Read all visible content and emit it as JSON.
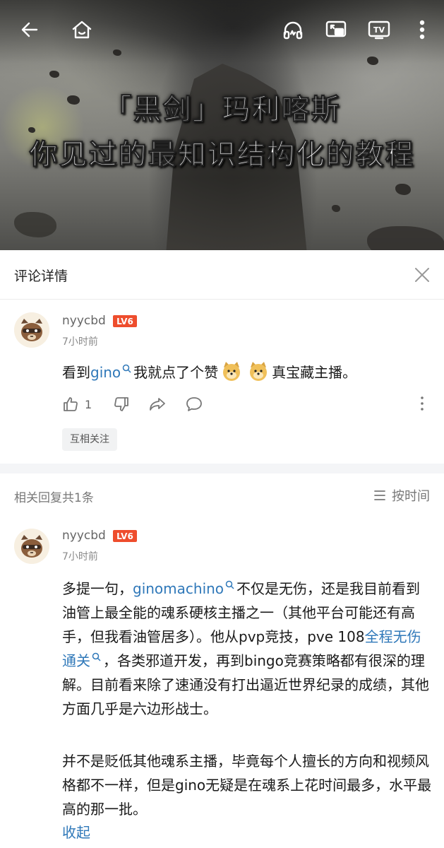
{
  "video": {
    "title_line1": "「黑剑」玛利喀斯",
    "title_line2": "你见过的最知识结构化的教程"
  },
  "topbar_icons": [
    "back-icon",
    "home-icon",
    "headphones-icon",
    "picture-in-picture-icon",
    "tv-cast-icon",
    "more-vertical-icon"
  ],
  "detail": {
    "title": "评论详情"
  },
  "main_comment": {
    "username": "nyycbd",
    "level": "LV6",
    "time": "7小时前",
    "text_before_link": "看到",
    "link": "gino",
    "text_after_link": "我就点了个赞",
    "text_after_emojis": "真宝藏主播。",
    "like_count": "1",
    "tag": "互相关注"
  },
  "replies": {
    "count_label": "相关回复共1条",
    "sort_label": "按时间"
  },
  "reply": {
    "username": "nyycbd",
    "level": "LV6",
    "time": "7小时前",
    "p1_a": "多提一句，",
    "p1_link": "ginomachino",
    "p1_b": "不仅是无伤，还是我目前看到油管上最全能的魂系硬核主播之一（其他平台可能还有高手，但我看油管居多）。他从pvp竞技，pve 108",
    "p1_link2": "全程无伤通关",
    "p1_c": "，各类邪道开发，再到bingo竞赛策略都有很深的理解。目前看来除了速通没有打出逼近世界纪录的成绩，其他方面几乎是六边形战士。",
    "p2": "并不是贬低其他魂系主播，毕竟每个人擅长的方向和视频风格都不一样，但是gino无疑是在魂系上花时间最多，水平最高的那一批。",
    "collapse": "收起"
  },
  "colors": {
    "link": "#2f78b9",
    "level_badge": "#ee4d2d"
  }
}
